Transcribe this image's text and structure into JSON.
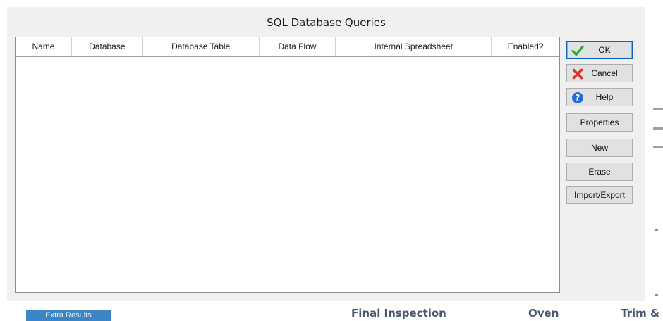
{
  "dialog": {
    "title": "SQL Database Queries",
    "columns": [
      "Name",
      "Database",
      "Database Table",
      "Data Flow",
      "Internal Spreadsheet",
      "Enabled?"
    ],
    "rows": [],
    "buttons": {
      "ok": "OK",
      "cancel": "Cancel",
      "help": "Help",
      "properties": "Properties",
      "new": "New",
      "erase": "Erase",
      "import_export": "Import/Export"
    }
  },
  "background": {
    "tab": "Extra Results",
    "labels": [
      "Final Inspection",
      "Oven",
      "Trim &"
    ]
  },
  "colors": {
    "ok_check": "#2ea82e",
    "cancel_x": "#d9342b",
    "help_circle": "#1f6fd1",
    "tab_bg": "#3d86c6"
  }
}
